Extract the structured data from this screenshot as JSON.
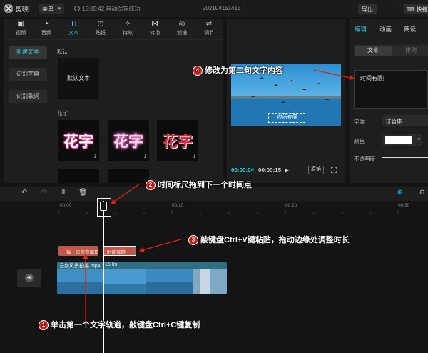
{
  "titlebar": {
    "app_name": "剪映",
    "menu_label": "菜单",
    "save_status": "15:09:42 自动保存成功",
    "project_name": "202104151415",
    "export_label": "导出",
    "shortcut_label": "快捷"
  },
  "media": {
    "tabs": [
      {
        "label": "视频",
        "icon": "video-icon"
      },
      {
        "label": "音频",
        "icon": "audio-icon"
      },
      {
        "label": "文本",
        "icon": "text-icon",
        "glyph": "TI"
      },
      {
        "label": "贴纸",
        "icon": "sticker-icon"
      },
      {
        "label": "特效",
        "icon": "effects-icon"
      },
      {
        "label": "转场",
        "icon": "transition-icon"
      },
      {
        "label": "滤镜",
        "icon": "filter-icon"
      },
      {
        "label": "调节",
        "icon": "adjust-icon"
      }
    ],
    "side_buttons": [
      "新建文本",
      "识别字幕",
      "识别歌词"
    ],
    "section_default": "默认",
    "default_text_card": "默认文本",
    "section_huazi": "花字",
    "huazi_sample": "花字"
  },
  "preview": {
    "caption": "时间有限",
    "time_current": "00:00:04",
    "time_total": "00:00:15",
    "ratio_label": "原始"
  },
  "props": {
    "tabs": [
      "编辑",
      "动画",
      "朗读"
    ],
    "subtabs": [
      "文本",
      "排列"
    ],
    "text_value": "时间有限",
    "font_label": "字体",
    "font_value": "拼音体",
    "color_label": "颜色",
    "color_value": "#ffffff",
    "opacity_label": "不透明度"
  },
  "timeline": {
    "ticks": [
      "00:00",
      "00:10",
      "00:20",
      "00:30"
    ],
    "text_clip_1": "每一段弯弯都是",
    "text_clip_2": "时间有限",
    "video_clip_name": "云南风景拍摄.mp4",
    "video_clip_duration": "15.0s"
  },
  "annotations": [
    {
      "num": "1",
      "text": "单击第一个文字轨道，敲键盘Ctrl+C键复制"
    },
    {
      "num": "2",
      "text": "时间标尺拖到下一个时间点"
    },
    {
      "num": "3",
      "text": "敲键盘Ctrl+V键粘贴，拖动边缘处调整时长"
    },
    {
      "num": "4",
      "text": "修改为第二句文字内容"
    }
  ],
  "colors": {
    "accent": "#3fd1e0",
    "text_clip": "#c0584a",
    "video_clip": "#2a6478",
    "callout_red": "#e0201a"
  }
}
